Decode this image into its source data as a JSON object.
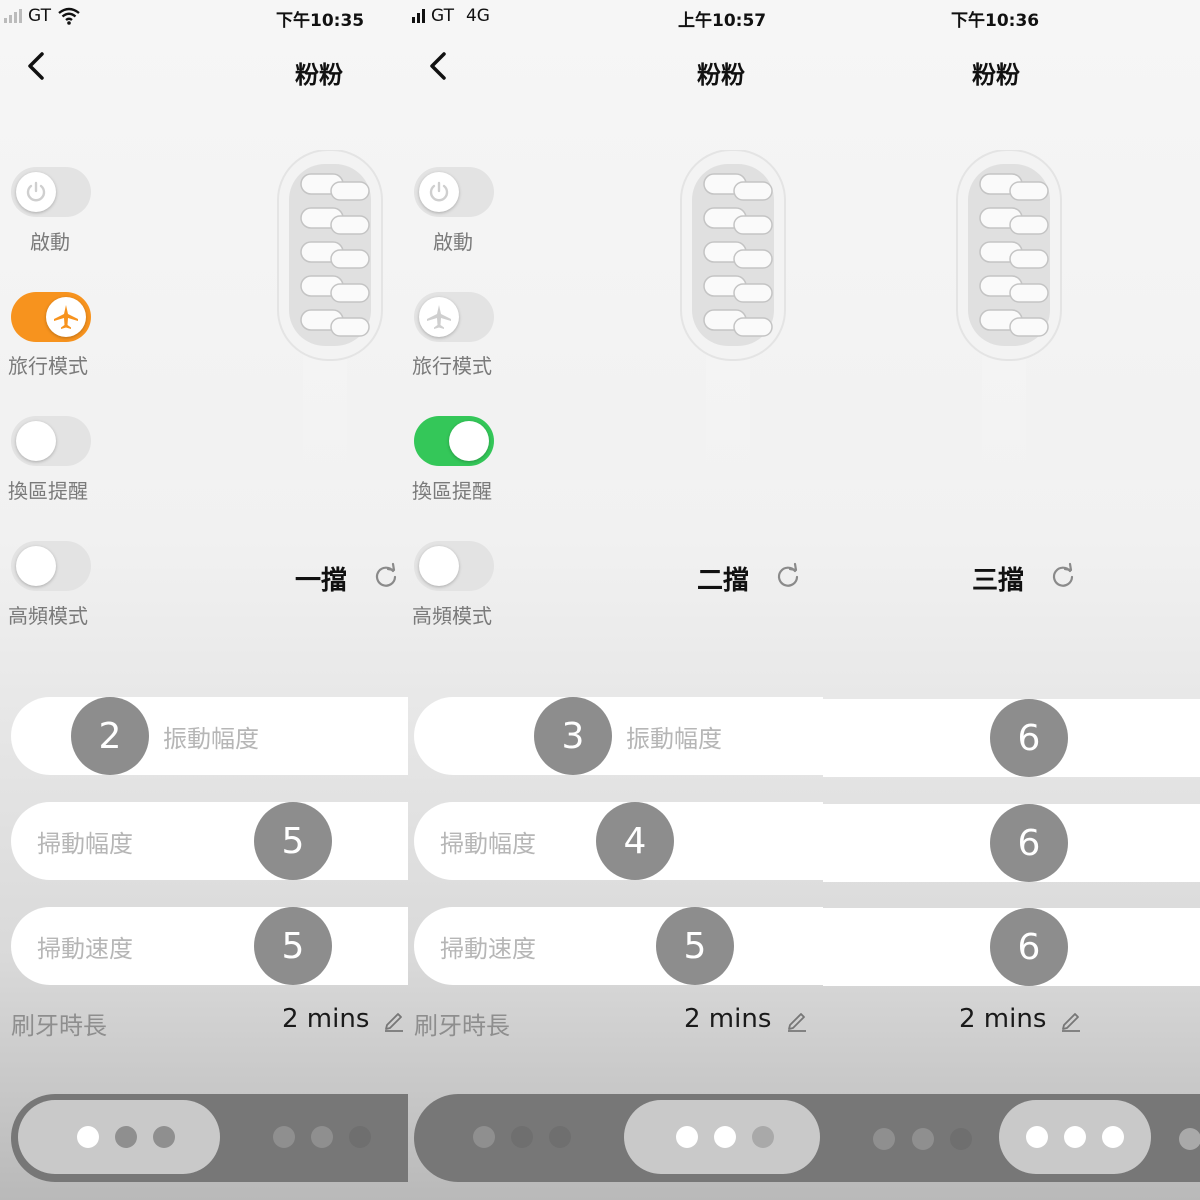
{
  "screens": [
    {
      "carrier": "GT",
      "network": "",
      "time": "下午10:35",
      "title": "粉粉",
      "toggles": [
        {
          "label": "啟動",
          "on": false
        },
        {
          "label": "旅行模式",
          "on": true
        },
        {
          "label": "換區提醒",
          "on": false
        },
        {
          "label": "高頻模式",
          "on": false
        }
      ],
      "mode": "一擋",
      "sliders": [
        {
          "label": "振動幅度",
          "value": "2"
        },
        {
          "label": "掃動幅度",
          "value": "5"
        },
        {
          "label": "掃動速度",
          "value": "5"
        }
      ],
      "duration_label": "刷牙時長",
      "duration": "2 mins"
    },
    {
      "carrier": "GT",
      "network": "4G",
      "time": "上午10:57",
      "title": "粉粉",
      "toggles": [
        {
          "label": "啟動",
          "on": false
        },
        {
          "label": "旅行模式",
          "on": false
        },
        {
          "label": "換區提醒",
          "on": true
        },
        {
          "label": "高頻模式",
          "on": false
        }
      ],
      "mode": "二擋",
      "sliders": [
        {
          "label": "振動幅度",
          "value": "3"
        },
        {
          "label": "掃動幅度",
          "value": "4"
        },
        {
          "label": "掃動速度",
          "value": "5"
        }
      ],
      "duration_label": "刷牙時長",
      "duration": "2 mins"
    },
    {
      "time": "下午10:36",
      "title": "粉粉",
      "mode": "三擋",
      "sliders": [
        {
          "value": "6"
        },
        {
          "value": "6"
        },
        {
          "value": "6"
        }
      ],
      "duration": "2 mins"
    }
  ],
  "colors": {
    "travel_on": "#f7931e",
    "reminder_on": "#34c759",
    "thumb": "#8d8d8d"
  },
  "icons": [
    "back-chevron-icon",
    "power-icon",
    "airplane-icon",
    "refresh-icon",
    "pencil-icon",
    "toothbrush-head-image"
  ]
}
